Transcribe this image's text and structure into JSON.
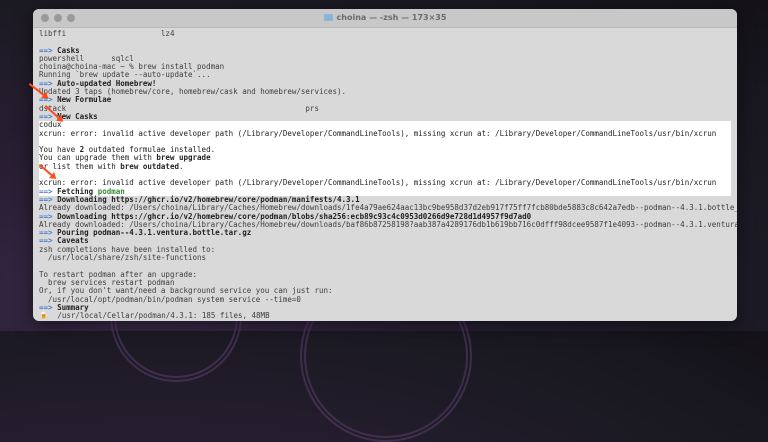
{
  "window": {
    "title": "choina — -zsh — 173×35"
  },
  "lines": [
    {
      "segs": [
        {
          "t": "libffi                     lz4"
        }
      ]
    },
    {
      "segs": [
        {
          "t": ""
        }
      ]
    },
    {
      "segs": [
        {
          "t": "==> ",
          "c": "arrow"
        },
        {
          "t": "Casks",
          "c": "b"
        }
      ]
    },
    {
      "segs": [
        {
          "t": "powershell      sqlcl"
        }
      ]
    },
    {
      "segs": [
        {
          "t": "choina@choina-mac ~ % brew install podman"
        }
      ]
    },
    {
      "segs": [
        {
          "t": "Running `brew update --auto-update`..."
        }
      ]
    },
    {
      "segs": [
        {
          "t": "==> ",
          "c": "arrow"
        },
        {
          "t": "Auto-updated Homebrew!",
          "c": "b"
        }
      ]
    },
    {
      "segs": [
        {
          "t": "Updated 3 taps (homebrew/core, homebrew/cask and homebrew/services)."
        }
      ]
    },
    {
      "segs": [
        {
          "t": "==> ",
          "c": "arrow"
        },
        {
          "t": "New Formulae",
          "c": "b"
        }
      ]
    },
    {
      "segs": [
        {
          "t": "dstack                                                     prs"
        }
      ]
    },
    {
      "segs": [
        {
          "t": "==> ",
          "c": "arrow"
        },
        {
          "t": "New Casks",
          "c": "b"
        }
      ]
    },
    {
      "hl": true,
      "segs": [
        {
          "t": "codux"
        }
      ]
    },
    {
      "hl": true,
      "segs": [
        {
          "t": "xcrun: error: invalid active developer path (/Library/Developer/CommandLineTools), missing xcrun at: /Library/Developer/CommandLineTools/usr/bin/xcrun"
        }
      ]
    },
    {
      "hl": true,
      "segs": [
        {
          "t": ""
        }
      ]
    },
    {
      "hl": true,
      "segs": [
        {
          "t": "You have "
        },
        {
          "t": "2",
          "c": "b"
        },
        {
          "t": " outdated formulae installed."
        }
      ]
    },
    {
      "hl": true,
      "segs": [
        {
          "t": "You can upgrade them with "
        },
        {
          "t": "brew upgrade",
          "c": "b"
        }
      ]
    },
    {
      "hl": true,
      "segs": [
        {
          "t": "or list them with "
        },
        {
          "t": "brew outdated",
          "c": "b"
        },
        {
          "t": "."
        }
      ]
    },
    {
      "hl": true,
      "segs": [
        {
          "t": ""
        }
      ]
    },
    {
      "hl": true,
      "segs": [
        {
          "t": "xcrun: error: invalid active developer path (/Library/Developer/CommandLineTools), missing xcrun at: /Library/Developer/CommandLineTools/usr/bin/xcrun"
        }
      ]
    },
    {
      "hl": true,
      "segs": [
        {
          "t": "==> ",
          "c": "arrow"
        },
        {
          "t": "Fetching ",
          "c": "b"
        },
        {
          "t": "podman",
          "c": "green"
        }
      ]
    },
    {
      "segs": [
        {
          "t": "==> ",
          "c": "arrow"
        },
        {
          "t": "Downloading https://ghcr.io/v2/homebrew/core/podman/manifests/4.3.1",
          "c": "b"
        }
      ]
    },
    {
      "segs": [
        {
          "t": "Already downloaded: /Users/choina/Library/Caches/Homebrew/downloads/1fe4a79ae624aac13bc9be958d37d2eb917f75ff7fcb80bde5883c8c642a7edb--podman--4.3.1.bottle_manifest.json"
        }
      ]
    },
    {
      "segs": [
        {
          "t": "==> ",
          "c": "arrow"
        },
        {
          "t": "Downloading https://ghcr.io/v2/homebrew/core/podman/blobs/sha256:ecb89c93c4c0953d0266d9e728d1d4957f9d7ad0",
          "c": "b"
        }
      ]
    },
    {
      "segs": [
        {
          "t": "Already downloaded: /Users/choina/Library/Caches/Homebrew/downloads/baf86b87258198?aab387a4289176db1b619bb716c0dfff98dcee9587f1e4093--podman--4.3.1.ventura.bottle.tar.gz"
        }
      ]
    },
    {
      "segs": [
        {
          "t": "==> ",
          "c": "arrow"
        },
        {
          "t": "Pouring podman--4.3.1.ventura.bottle.tar.gz",
          "c": "b"
        }
      ]
    },
    {
      "segs": [
        {
          "t": "==> ",
          "c": "arrow"
        },
        {
          "t": "Caveats",
          "c": "b"
        }
      ]
    },
    {
      "segs": [
        {
          "t": "zsh completions have been installed to:"
        }
      ]
    },
    {
      "segs": [
        {
          "t": "  /usr/local/share/zsh/site-functions"
        }
      ]
    },
    {
      "segs": [
        {
          "t": ""
        }
      ]
    },
    {
      "segs": [
        {
          "t": "To restart podman after an upgrade:"
        }
      ]
    },
    {
      "segs": [
        {
          "t": "  brew services restart podman"
        }
      ]
    },
    {
      "segs": [
        {
          "t": "Or, if you don't want/need a background service you can just run:"
        }
      ]
    },
    {
      "segs": [
        {
          "t": "  /usr/local/opt/podman/bin/podman system service --time=0"
        }
      ]
    },
    {
      "segs": [
        {
          "t": "==> ",
          "c": "arrow"
        },
        {
          "t": "Summary",
          "c": "b"
        }
      ]
    },
    {
      "segs": [
        {
          "t": "🍺  /usr/local/Cellar/podman/4.3.1: 185 files, 48MB"
        }
      ]
    }
  ]
}
